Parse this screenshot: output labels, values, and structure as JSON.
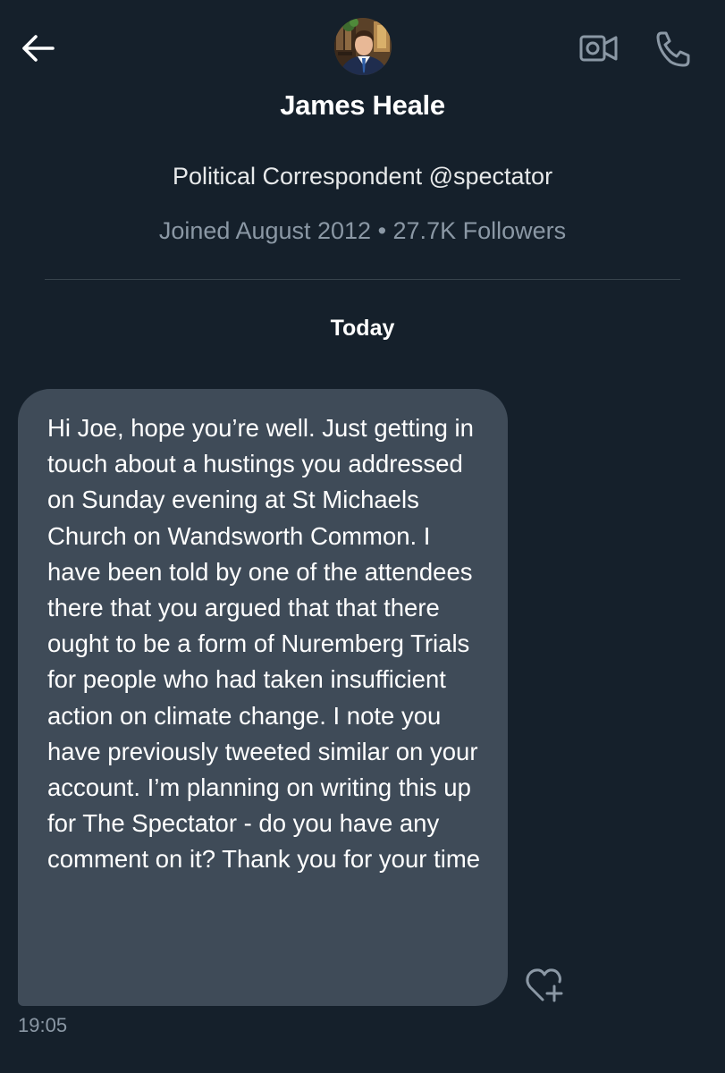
{
  "header": {
    "back_icon": "arrow-left-icon",
    "video_icon": "video-camera-icon",
    "call_icon": "phone-icon"
  },
  "profile": {
    "name": "James Heale",
    "bio": "Political Correspondent @spectator",
    "meta": "Joined August 2012 • 27.7K Followers"
  },
  "conversation": {
    "date_separator": "Today",
    "messages": [
      {
        "text": "Hi Joe, hope you’re well. Just getting in touch about a hustings you addressed on Sunday evening at St Michaels Church on Wandsworth Common. I have been told by one of the attendees there that you argued that that there ought to be a form of Nuremberg Trials for people who had taken insufficient action on climate change. I note you have previously tweeted similar on your account. I’m planning on writing this up for The Spectator - do you have any comment on it? Thank you for your time",
        "time": "19:05",
        "reaction_icon": "heart-plus-icon"
      }
    ]
  },
  "colors": {
    "background": "#15202b",
    "bubble": "#3f4b58",
    "secondary_text": "#8b98a5",
    "divider": "#38444d"
  }
}
